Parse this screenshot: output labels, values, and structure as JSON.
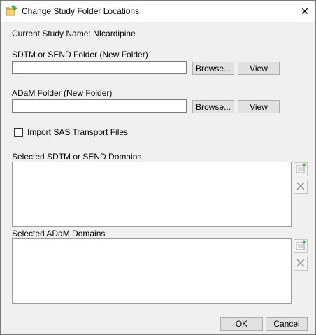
{
  "window": {
    "title": "Change Study Folder Locations",
    "close_glyph": "✕"
  },
  "study": {
    "label": "Current Study Name: NIcardipine"
  },
  "sdtm": {
    "label": "SDTM or SEND Folder (New Folder)",
    "value": "",
    "browse_label": "Browse...",
    "view_label": "View"
  },
  "adam": {
    "label": "ADaM Folder (New Folder)",
    "value": "",
    "browse_label": "Browse...",
    "view_label": "View"
  },
  "import_sas": {
    "label": "Import SAS Transport Files",
    "checked": false
  },
  "selected_sdtm": {
    "label": "Selected SDTM or SEND Domains",
    "items": []
  },
  "selected_adam": {
    "label": "Selected ADaM Domains",
    "items": []
  },
  "footer": {
    "ok_label": "OK",
    "cancel_label": "Cancel"
  },
  "icons": {
    "title": "folder-swap-icon",
    "add": "add-list-icon",
    "remove": "remove-x-icon"
  },
  "colors": {
    "accent_green": "#4caf50",
    "icon_gray": "#9a9a9a"
  }
}
